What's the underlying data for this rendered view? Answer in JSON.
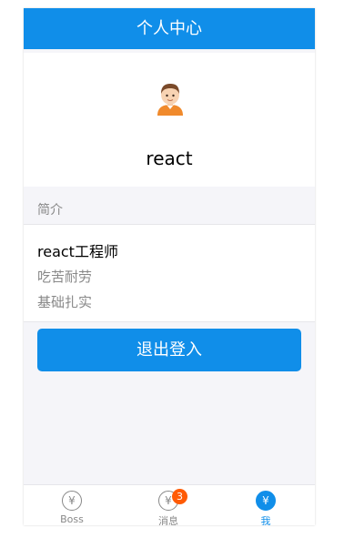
{
  "navbar": {
    "title": "个人中心"
  },
  "profile": {
    "avatar_icon": "boy-avatar-icon",
    "username": "react"
  },
  "intro": {
    "section_title": "简介",
    "title": "react工程师",
    "lines": [
      "吃苦耐劳",
      "基础扎实"
    ]
  },
  "logout_label": "退出登入",
  "tabbar": {
    "tabs": [
      {
        "label": "Boss",
        "icon": "¥",
        "active": false
      },
      {
        "label": "消息",
        "icon": "¥",
        "badge": "3",
        "active": false
      },
      {
        "label": "我",
        "icon": "¥",
        "active": true
      }
    ]
  },
  "colors": {
    "primary": "#108ee9",
    "badge": "#ff5b05",
    "background": "#f5f5f9"
  }
}
